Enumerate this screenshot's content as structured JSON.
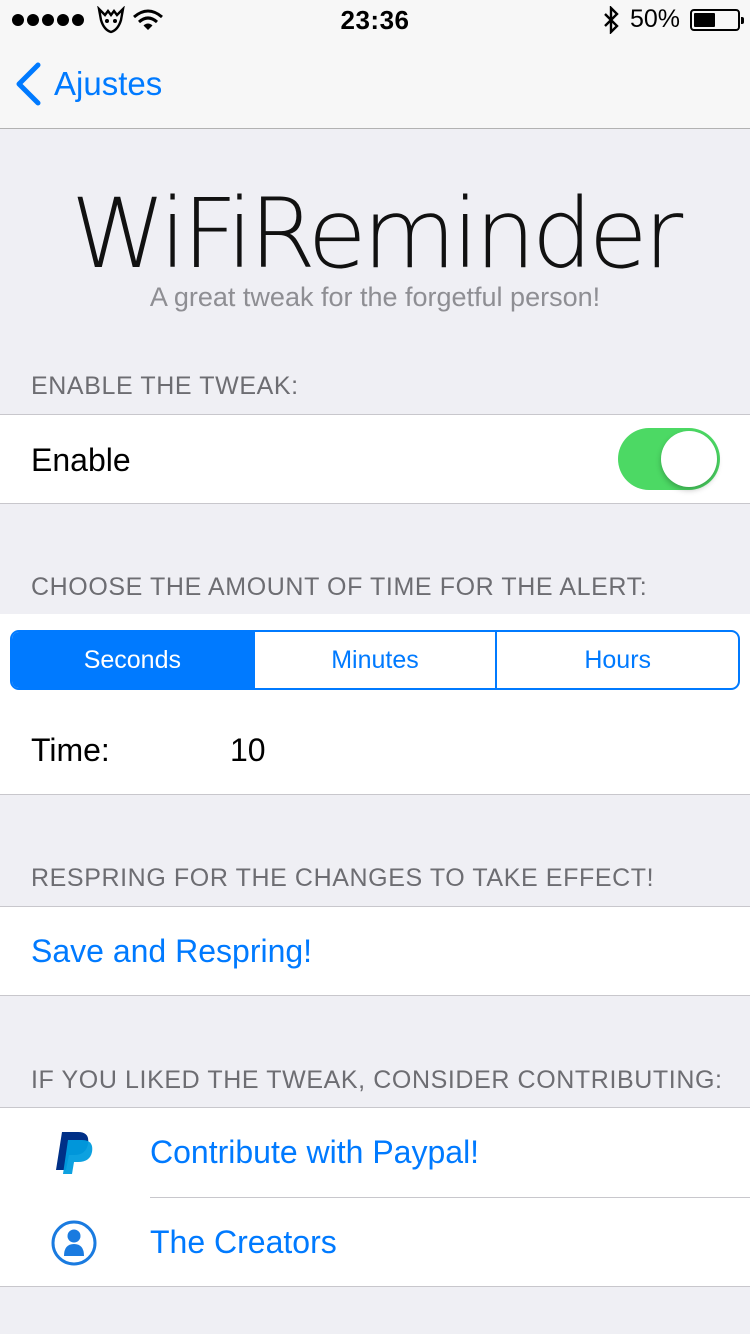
{
  "status_bar": {
    "time": "23:36",
    "battery_percent": "50%",
    "battery_level": 0.5,
    "signal_bars": 5
  },
  "nav": {
    "back_label": "Ajustes"
  },
  "header": {
    "title": "WiFiReminder",
    "subtitle": "A great tweak for the forgetful person!"
  },
  "enable_section": {
    "header": "ENABLE THE TWEAK:",
    "label": "Enable",
    "toggle_on": true
  },
  "time_section": {
    "header": "CHOOSE THE AMOUNT OF TIME FOR THE ALERT:",
    "segments": [
      "Seconds",
      "Minutes",
      "Hours"
    ],
    "selected": "Seconds",
    "time_label": "Time:",
    "time_value": "10"
  },
  "respring_section": {
    "header": "RESPRING FOR THE CHANGES TO TAKE EFFECT!",
    "button_label": "Save and Respring!"
  },
  "contribute_section": {
    "header": "IF YOU LIKED THE TWEAK, CONSIDER CONTRIBUTING:",
    "paypal_label": "Contribute with Paypal!",
    "creators_label": "The Creators"
  },
  "colors": {
    "accent": "#007aff",
    "toggle_on": "#4cd964",
    "background": "#efeff4"
  },
  "icons": [
    "carrier-icon",
    "wifi-icon",
    "bluetooth-icon",
    "battery-icon",
    "back-chevron-icon",
    "paypal-icon",
    "person-icon"
  ]
}
